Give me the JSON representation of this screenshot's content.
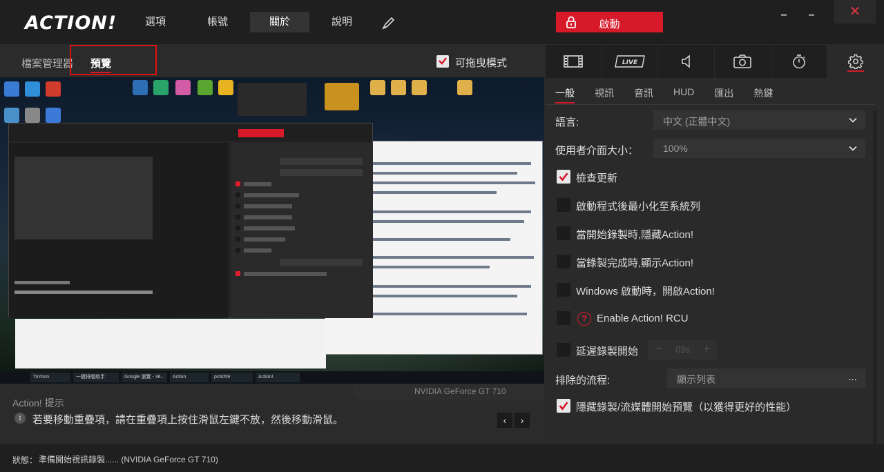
{
  "app": {
    "logo": "ACTION!",
    "nav": [
      "選項",
      "帳號",
      "關於",
      "說明"
    ],
    "active_nav": "關於",
    "record_label": "啟動",
    "close_glyph": "✕"
  },
  "left": {
    "tabs": [
      "檔案管理器",
      "預覽"
    ],
    "active_tab": "預覽",
    "drag_mode_label": "可拖曳模式",
    "drag_mode_checked": true
  },
  "preview": {
    "gpu_overlay": "NVIDIA GeForce GT 710",
    "taskbar_items": [
      "ToYoon",
      "一鍵排版助手(MyE...",
      "Google 瀏覽 - 36...",
      "Action",
      "pc6059",
      "Action!"
    ]
  },
  "tips": {
    "title": "Action! 提示",
    "text": "若要移動重疊項，請在重疊項上按住滑鼠左鍵不放，然後移動滑鼠。",
    "prev": "‹",
    "next": "›"
  },
  "status": {
    "label": "狀態：",
    "text": "準備開始視訊錄製......  (NVIDIA GeForce GT 710)"
  },
  "settings": {
    "icon_tabs": [
      "film-icon",
      "live-icon",
      "speaker-icon",
      "camera-icon",
      "timer-icon",
      "gear-icon"
    ],
    "active_icon_tab": "gear-icon",
    "live_text": "LIVE",
    "subtabs": [
      "一般",
      "視訊",
      "音訊",
      "HUD",
      "匯出",
      "熱鍵"
    ],
    "active_subtab": "一般",
    "language_label": "語言:",
    "language_value": "中文 (正體中文)",
    "ui_size_label": "使用者介面大小：",
    "ui_size_value": "100%",
    "options": [
      {
        "label": "檢查更新",
        "checked": true
      },
      {
        "label": "啟動程式後最小化至系統列",
        "checked": false
      },
      {
        "label": "當開始錄製時,隱藏Action!",
        "checked": false
      },
      {
        "label": "當錄製完成時,顯示Action!",
        "checked": false
      },
      {
        "label": "Windows 啟動時，開啟Action!",
        "checked": false
      },
      {
        "label": "Enable Action! RCU",
        "checked": false
      },
      {
        "label": "延遲錄製開始",
        "checked": false
      }
    ],
    "delay_value": "03s",
    "excluded_label": "排除的流程:",
    "excluded_value": "顯示列表",
    "excluded_button": "...",
    "hide_preview_label": "隱藏錄製/流媒體開始預覽（以獲得更好的性能）",
    "hide_preview_checked": true
  },
  "colors": {
    "accent": "#d71a2a",
    "background": "#2b2b2b",
    "topbar": "#1f1f1f"
  }
}
